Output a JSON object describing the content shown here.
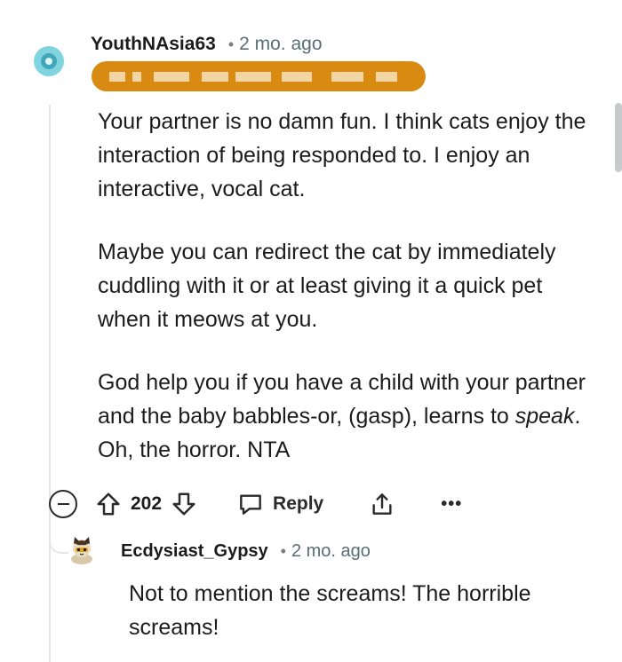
{
  "comment": {
    "username": "YouthNAsia63",
    "separator": "•",
    "time_ago": "2 mo. ago",
    "flair_redacted": true,
    "paragraphs": [
      {
        "text": "Your partner is no damn fun. I think cats enjoy the interaction of being responded to. I enjoy an interactive, vocal cat."
      },
      {
        "text": "Maybe you can redirect the cat by immediately cuddling with it or at least giving it a quick pet when it meows at you."
      },
      {
        "before": "God help you if you have a child with your partner and the baby babbles-or, (gasp), learns to ",
        "emphasis": "speak",
        "after": ". Oh, the horror. NTA"
      }
    ],
    "actions": {
      "score": "202",
      "reply_label": "Reply",
      "more_label": "•••"
    }
  },
  "reply": {
    "username": "Ecdysiast_Gypsy",
    "separator": "•",
    "time_ago": "2 mo. ago",
    "text": "Not to mention the screams! The horrible screams!"
  },
  "colors": {
    "flair_background": "#d98a10",
    "thread_line": "#e4e6e8",
    "avatar_main": "#7fd4e0",
    "meta_text": "#576f76"
  },
  "icons": [
    "snoo-avatar-icon",
    "collapse-icon",
    "upvote-icon",
    "downvote-icon",
    "reply-bubble-icon",
    "share-icon",
    "more-icon",
    "cat-avatar-icon"
  ]
}
